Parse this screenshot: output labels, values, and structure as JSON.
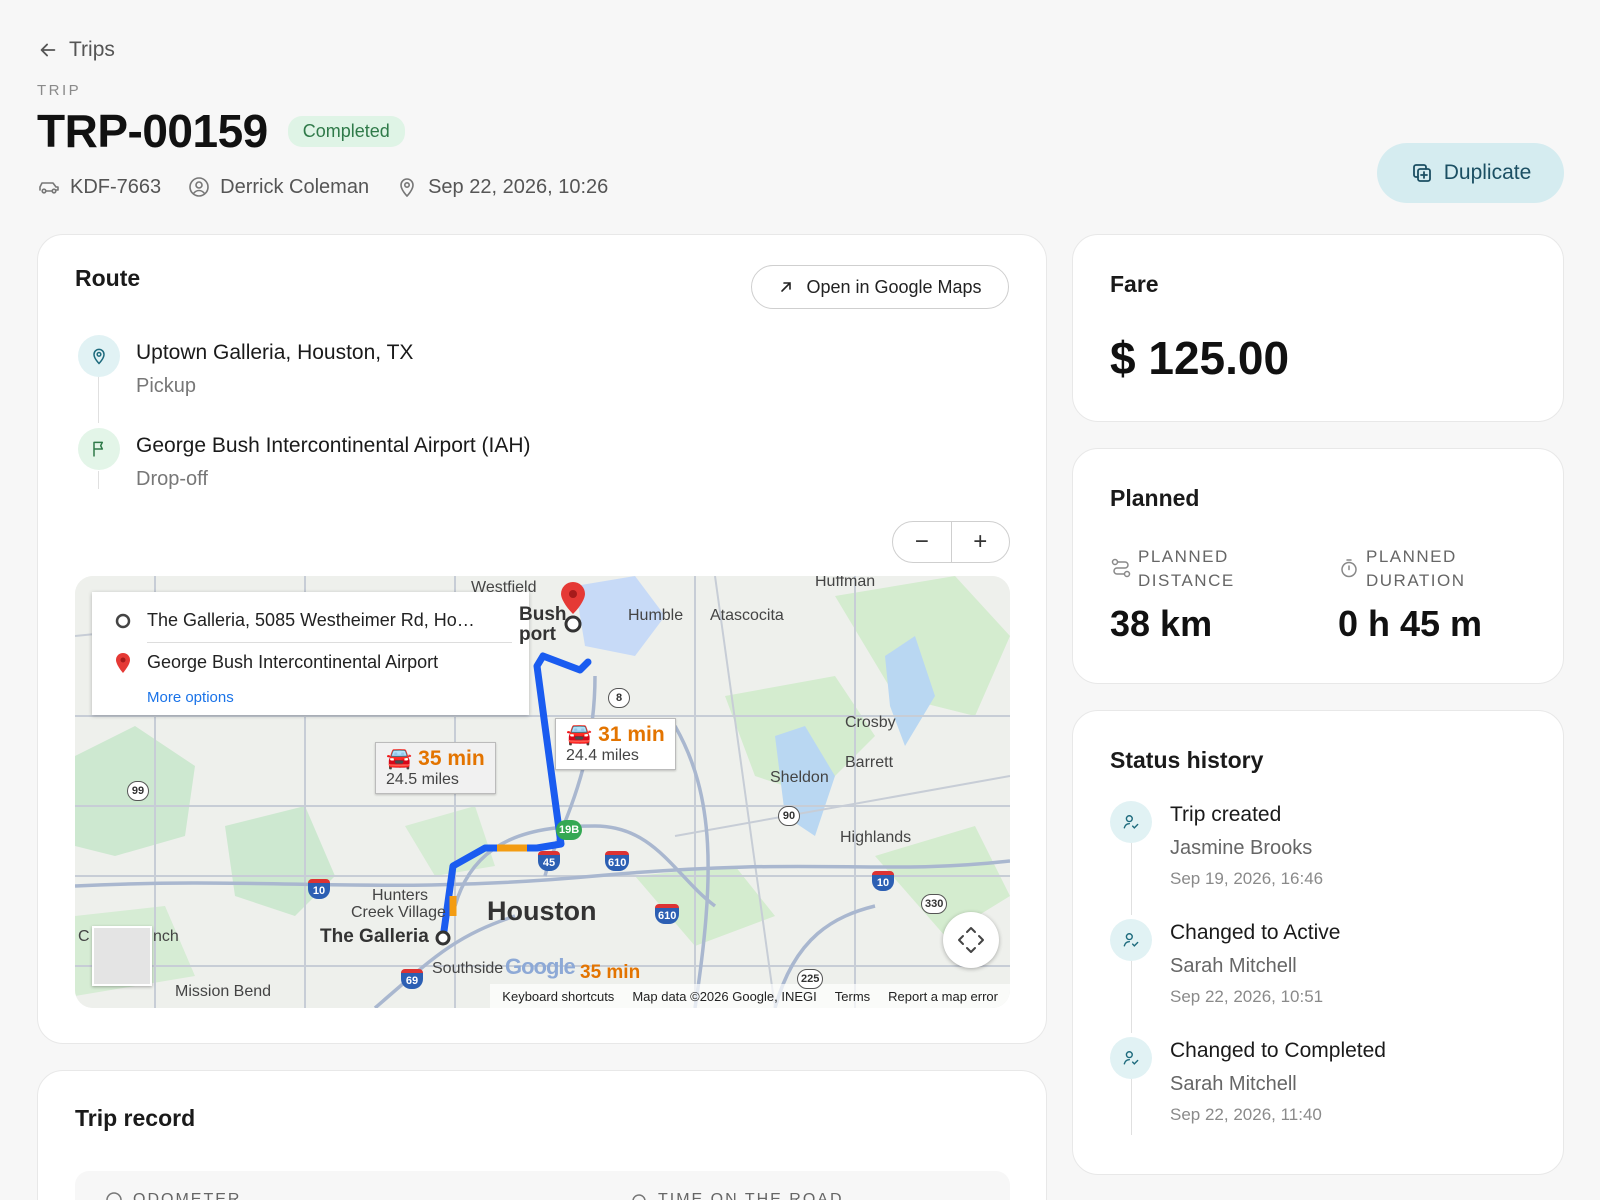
{
  "header": {
    "back_label": "Trips",
    "eyebrow": "TRIP",
    "trip_id": "TRP-00159",
    "status": "Completed",
    "vehicle": "KDF-7663",
    "driver": "Derrick Coleman",
    "datetime": "Sep 22, 2026, 10:26",
    "duplicate_label": "Duplicate"
  },
  "route": {
    "title": "Route",
    "open_maps_label": "Open in Google Maps",
    "pickup": {
      "name": "Uptown Galleria, Houston, TX",
      "role": "Pickup"
    },
    "dropoff": {
      "name": "George Bush Intercontinental Airport (IAH)",
      "role": "Drop-off"
    },
    "zoom_out": "−",
    "zoom_in": "+",
    "map": {
      "from": "The Galleria, 5085 Westheimer Rd, Ho…",
      "to": "George Bush Intercontinental Airport",
      "more_options": "More options",
      "option_fast": {
        "time": "31 min",
        "distance": "24.4 miles"
      },
      "option_alt": {
        "time": "35 min",
        "distance": "24.5 miles"
      },
      "option_third_time": "35 min",
      "places": [
        "Westfield",
        "Bush",
        "port",
        "Humble",
        "Atascocita",
        "Huffman",
        "Crosby",
        "Barrett",
        "Sheldon",
        "Highlands",
        "Hunters",
        "Creek Village",
        "The Galleria",
        "Houston",
        "Southside",
        "Mission Bend",
        "C",
        "nch",
        "ow"
      ],
      "shields": [
        "8",
        "99",
        "10",
        "45",
        "610",
        "610",
        "10",
        "69",
        "90",
        "330",
        "225",
        "19B"
      ],
      "logo": "Google",
      "footer": [
        "Keyboard shortcuts",
        "Map data ©2026 Google, INEGI",
        "Terms",
        "Report a map error"
      ]
    }
  },
  "trip_record": {
    "title": "Trip record",
    "fields": [
      "ODOMETER",
      "TIME ON THE ROAD"
    ]
  },
  "fare": {
    "title": "Fare",
    "amount": "$ 125.00"
  },
  "planned": {
    "title": "Planned",
    "distance_label_1": "PLANNED",
    "distance_label_2": "DISTANCE",
    "distance_value": "38 km",
    "duration_label_1": "PLANNED",
    "duration_label_2": "DURATION",
    "duration_value": "0 h 45 m"
  },
  "history": {
    "title": "Status history",
    "events": [
      {
        "title": "Trip created",
        "by": "Jasmine Brooks",
        "at": "Sep 19, 2026, 16:46"
      },
      {
        "title": "Changed to Active",
        "by": "Sarah Mitchell",
        "at": "Sep 22, 2026, 10:51"
      },
      {
        "title": "Changed to Completed",
        "by": "Sarah Mitchell",
        "at": "Sep 22, 2026, 11:40"
      }
    ]
  },
  "colors": {
    "accent": "#d5ecf0",
    "status_green": "#2f7a49",
    "route_blue": "#1a5cf0"
  }
}
